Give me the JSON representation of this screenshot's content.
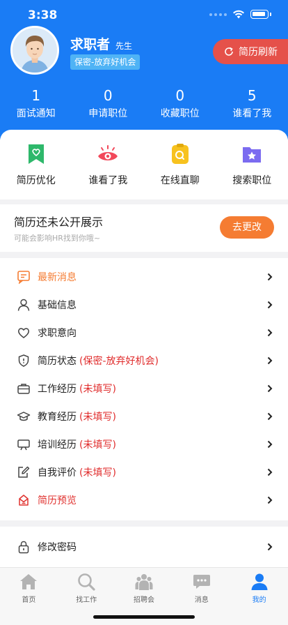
{
  "status": {
    "time": "3:38"
  },
  "profile": {
    "name": "求职者",
    "gender": "先生",
    "privacy_badge": "保密-放弃好机会",
    "refresh_label": "简历刷新"
  },
  "stats": [
    {
      "value": "1",
      "label": "面试通知"
    },
    {
      "value": "0",
      "label": "申请职位"
    },
    {
      "value": "0",
      "label": "收藏职位"
    },
    {
      "value": "5",
      "label": "谁看了我"
    }
  ],
  "quick_actions": [
    {
      "label": "简历优化",
      "icon": "bookmark-heart-icon"
    },
    {
      "label": "谁看了我",
      "icon": "eye-icon"
    },
    {
      "label": "在线直聊",
      "icon": "chat-icon"
    },
    {
      "label": "搜索职位",
      "icon": "star-folder-icon"
    }
  ],
  "notice": {
    "title": "简历还未公开展示",
    "subtitle": "可能会影响HR找到你哦~",
    "button": "去更改"
  },
  "menu": [
    {
      "label": "最新消息",
      "extra": "",
      "icon": "message-icon"
    },
    {
      "label": "基础信息",
      "extra": "",
      "icon": "person-icon"
    },
    {
      "label": "求职意向",
      "extra": "",
      "icon": "heart-icon"
    },
    {
      "label": "简历状态",
      "extra": "(保密-放弃好机会)",
      "icon": "shield-icon"
    },
    {
      "label": "工作经历",
      "extra": "(未填写)",
      "icon": "briefcase-icon"
    },
    {
      "label": "教育经历",
      "extra": "(未填写)",
      "icon": "graduation-cap-icon"
    },
    {
      "label": "培训经历",
      "extra": "(未填写)",
      "icon": "easel-icon"
    },
    {
      "label": "自我评价",
      "extra": "(未填写)",
      "icon": "edit-icon"
    },
    {
      "label": "简历预览",
      "extra": "",
      "icon": "inbox-icon"
    }
  ],
  "settings": {
    "change_password": "修改密码",
    "icon": "lock-icon"
  },
  "tabs": [
    {
      "label": "首页",
      "icon": "home-icon"
    },
    {
      "label": "找工作",
      "icon": "search-icon"
    },
    {
      "label": "招聘会",
      "icon": "job-fair-icon"
    },
    {
      "label": "消息",
      "icon": "message-bubble-icon"
    },
    {
      "label": "我的",
      "icon": "profile-icon"
    }
  ],
  "colors": {
    "primary": "#1a7cf5",
    "accent_red": "#e5514a",
    "accent_orange": "#f57c32",
    "warning_text": "#e02b2b"
  }
}
